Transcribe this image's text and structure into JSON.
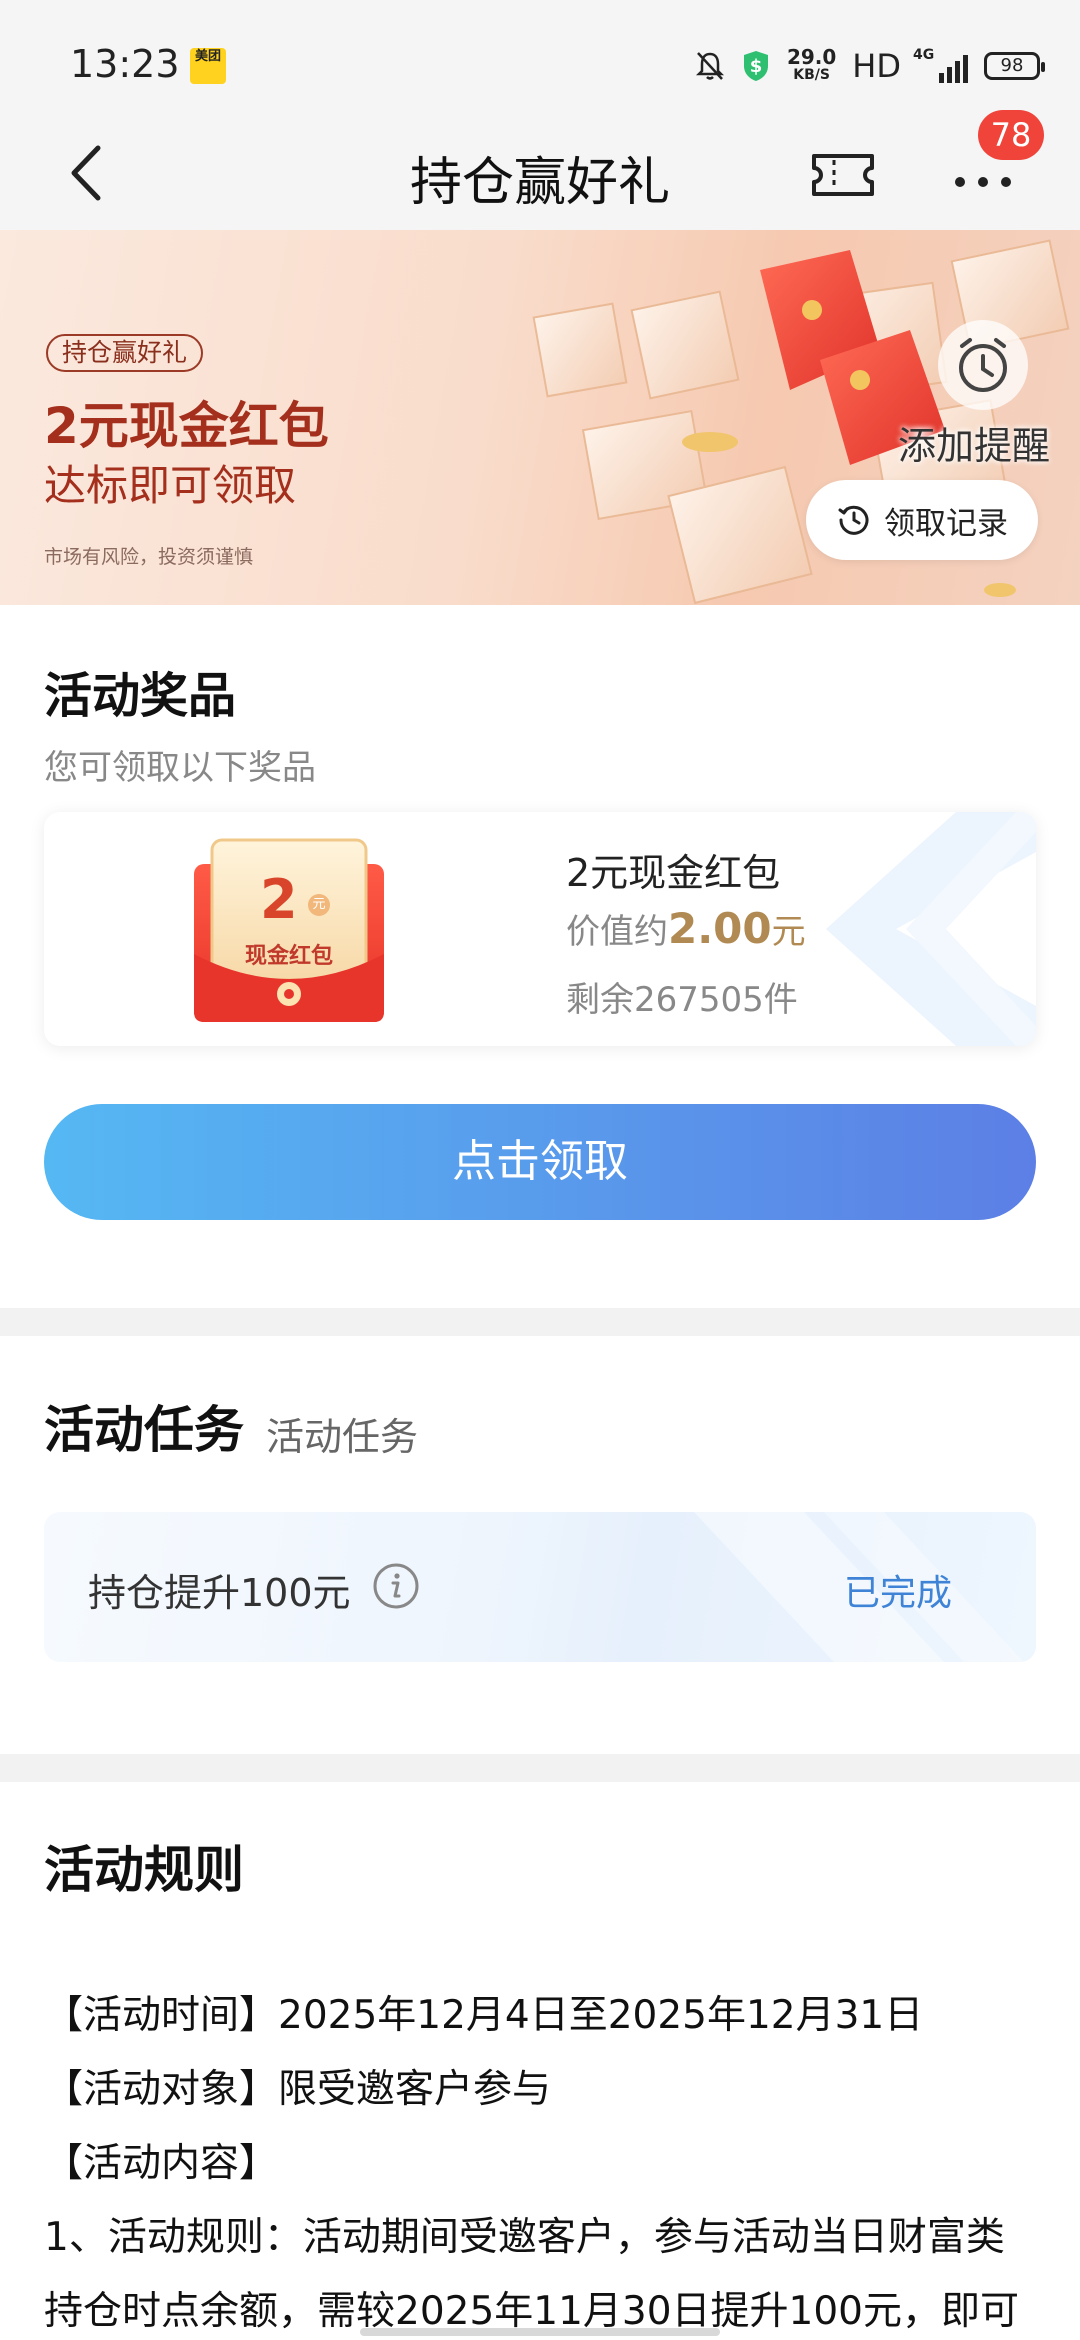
{
  "status_bar": {
    "time": "13:23",
    "app_icon_text": "美团",
    "speed_value": "29.0",
    "speed_unit": "KB/S",
    "hd": "HD",
    "network": "4G",
    "battery": "98"
  },
  "nav": {
    "title": "持仓赢好礼",
    "badge_count": "78",
    "icons": [
      "back-icon",
      "ticket-icon",
      "more-icon"
    ]
  },
  "banner": {
    "tag": "持仓赢好礼",
    "headline": "2元现金红包",
    "subline": "达标即可领取",
    "risk_notice": "市场有风险，投资须谨慎",
    "remind_label": "添加提醒",
    "record_label": "领取记录"
  },
  "prize_section": {
    "title": "活动奖品",
    "subtitle": "您可领取以下奖品",
    "envelope_amount": "2",
    "envelope_unit": "元",
    "envelope_label": "现金红包",
    "prize_name": "2元现金红包",
    "value_prefix": "价值约",
    "value_amount": "2.00",
    "value_unit": "元",
    "remaining": "剩余267505件",
    "claim_button": "点击领取"
  },
  "task_section": {
    "title": "活动任务",
    "subtitle": "活动任务",
    "task_label": "持仓提升100元",
    "task_status": "已完成"
  },
  "rules_section": {
    "title": "活动规则",
    "lines": [
      "【活动时间】2025年12月4日至2025年12月31日",
      "【活动对象】限受邀客户参与",
      "【活动内容】",
      "1、活动规则：活动期间受邀客户，参与活动当日财富类",
      "持仓时点余额，需较2025年11月30日提升100元，即可"
    ]
  },
  "colors": {
    "accent_blue_start": "#55b8f3",
    "accent_blue_end": "#5c7fe5",
    "banner_red": "#a32f1c",
    "badge_red": "#f0433a",
    "value_gold": "#b08a52",
    "status_blue": "#3e83d6"
  }
}
